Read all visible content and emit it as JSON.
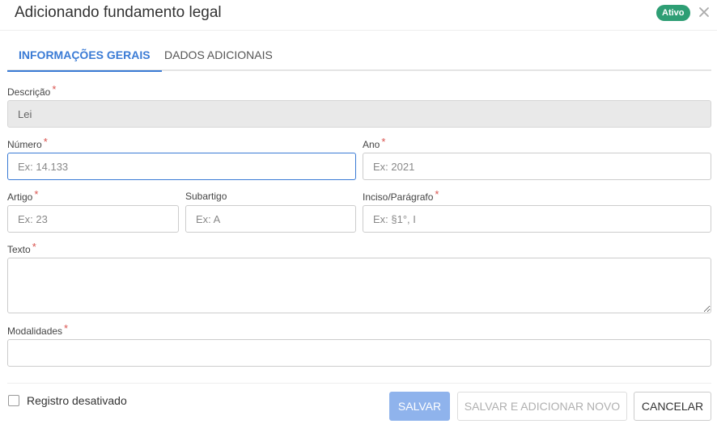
{
  "header": {
    "title": "Adicionando fundamento legal",
    "status_badge": "Ativo"
  },
  "tabs": [
    {
      "label": "INFORMAÇÕES GERAIS",
      "active": true
    },
    {
      "label": "DADOS ADICIONAIS",
      "active": false
    }
  ],
  "form": {
    "descricao": {
      "label": "Descrição",
      "required": "*",
      "value": "Lei"
    },
    "numero": {
      "label": "Número",
      "required": "*",
      "placeholder": "Ex: 14.133"
    },
    "ano": {
      "label": "Ano",
      "required": "*",
      "placeholder": "Ex: 2021"
    },
    "artigo": {
      "label": "Artigo",
      "required": "*",
      "placeholder": "Ex: 23"
    },
    "subartigo": {
      "label": "Subartigo",
      "placeholder": "Ex: A"
    },
    "inciso": {
      "label": "Inciso/Parágrafo",
      "required": "*",
      "placeholder": "Ex: §1°, I"
    },
    "texto": {
      "label": "Texto",
      "required": "*",
      "value": ""
    },
    "modalidades": {
      "label": "Modalidades",
      "required": "*",
      "value": ""
    }
  },
  "footer": {
    "checkbox_label": "Registro desativado",
    "save_label": "SALVAR",
    "save_new_label": "SALVAR E ADICIONAR NOVO",
    "cancel_label": "CANCELAR"
  },
  "colors": {
    "accent": "#3a7bd5",
    "badge": "#2e9e74",
    "required": "#d9534f"
  }
}
